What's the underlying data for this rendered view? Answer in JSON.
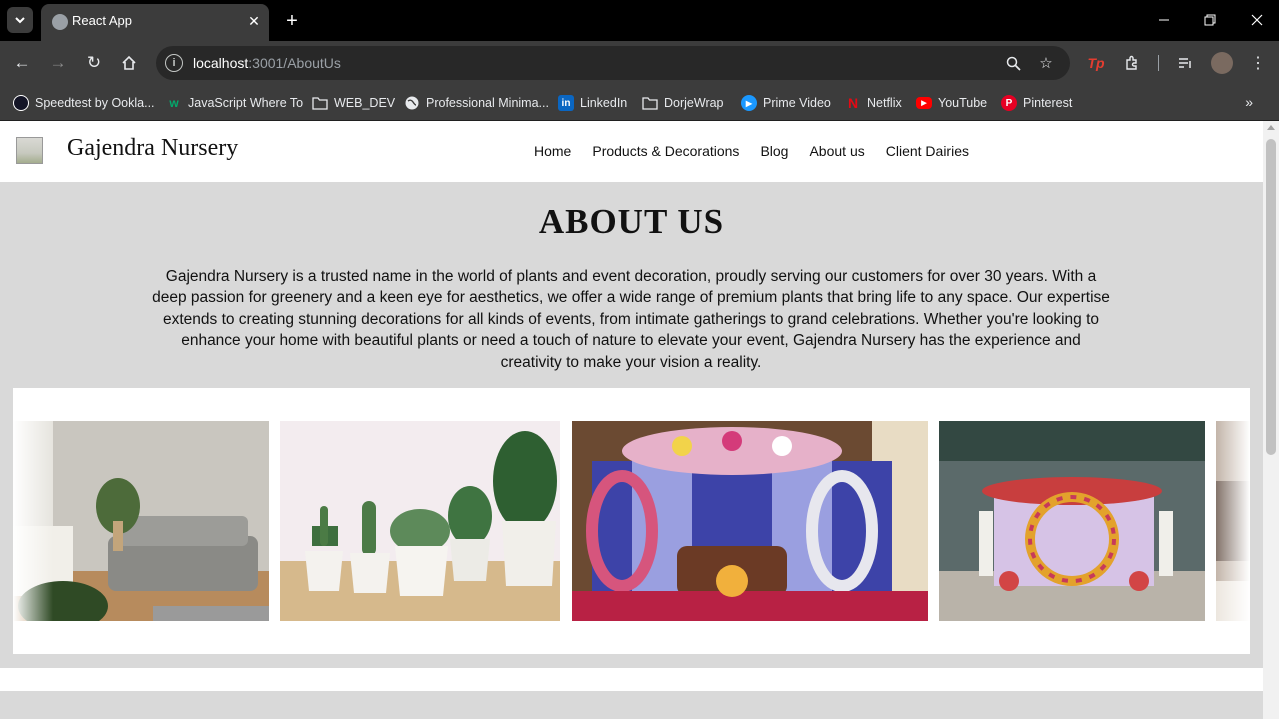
{
  "browser": {
    "tab_title": "React App",
    "url_host": "localhost",
    "url_rest": ":3001/AboutUs",
    "bookmarks": [
      {
        "label": "Speedtest by Ookla...",
        "icon": "speedtest-icon"
      },
      {
        "label": "JavaScript Where To",
        "icon": "w3schools-icon"
      },
      {
        "label": "WEB_DEV",
        "icon": "folder-icon"
      },
      {
        "label": "Professional Minima...",
        "icon": "globe-icon"
      },
      {
        "label": "LinkedIn",
        "icon": "linkedin-icon"
      },
      {
        "label": "DorjeWrap",
        "icon": "folder-icon"
      },
      {
        "label": "Prime Video",
        "icon": "prime-video-icon"
      },
      {
        "label": "Netflix",
        "icon": "netflix-icon"
      },
      {
        "label": "YouTube",
        "icon": "youtube-icon"
      },
      {
        "label": "Pinterest",
        "icon": "pinterest-icon"
      }
    ]
  },
  "site": {
    "brand": "Gajendra Nursery",
    "nav": [
      "Home",
      "Products & Decorations",
      "Blog",
      "About us",
      "Client Dairies"
    ]
  },
  "about": {
    "title": "ABOUT US",
    "text": "Gajendra Nursery is a trusted name in the world of plants and event decoration, proudly serving our customers for over 30 years. With a deep passion for greenery and a keen eye for aesthetics, we offer a wide range of premium plants that bring life to any space. Our expertise extends to creating stunning decorations for all kinds of events, from intimate gatherings to grand celebrations. Whether you're looking to enhance your home with beautiful plants or need a touch of nature to elevate your event, Gajendra Nursery has the experience and creativity to make your vision a reality."
  },
  "gallery": [
    "living-room-plant-photo",
    "potted-plants-photo",
    "floral-stage-decoration-photo",
    "floral-arch-decoration-photo",
    "partial-photo"
  ]
}
